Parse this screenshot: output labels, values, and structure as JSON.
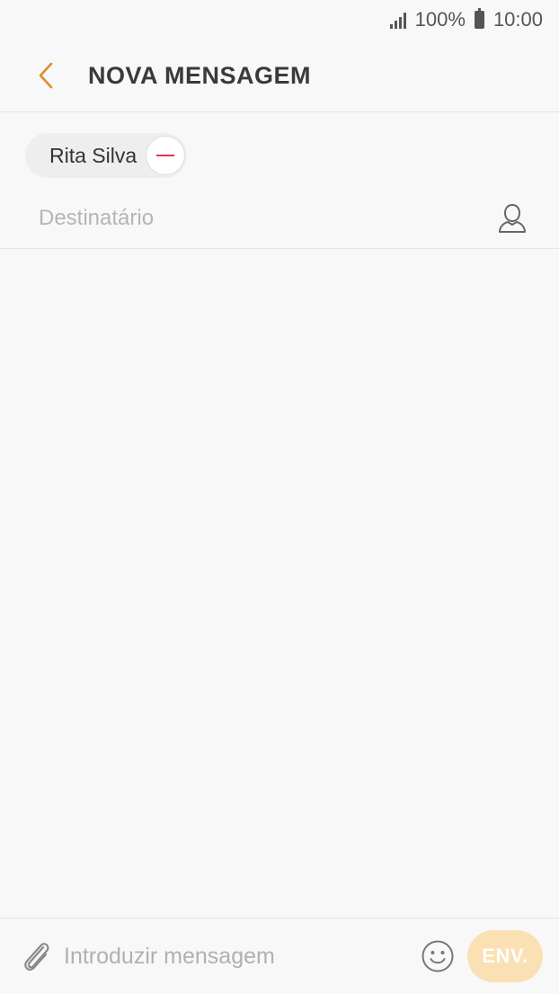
{
  "status_bar": {
    "battery": "100%",
    "time": "10:00",
    "icons": [
      "signal-icon",
      "battery-icon"
    ]
  },
  "app_bar": {
    "back_icon": "chevron-left-icon",
    "title": "NOVA MENSAGEM",
    "accent_color": "#e08a2e"
  },
  "recipients": {
    "chips": [
      {
        "label": "Rita Silva",
        "remove_icon": "minus-circle-icon"
      }
    ],
    "input_value": "",
    "input_placeholder": "Destinatário",
    "contact_icon": "person-icon"
  },
  "compose": {
    "attach_icon": "paperclip-icon",
    "input_value": "",
    "input_placeholder": "Introduzir mensagem",
    "emoji_icon": "smiley-icon",
    "send_label": "ENV.",
    "send_color": "#fbe0b4",
    "send_enabled": false
  }
}
